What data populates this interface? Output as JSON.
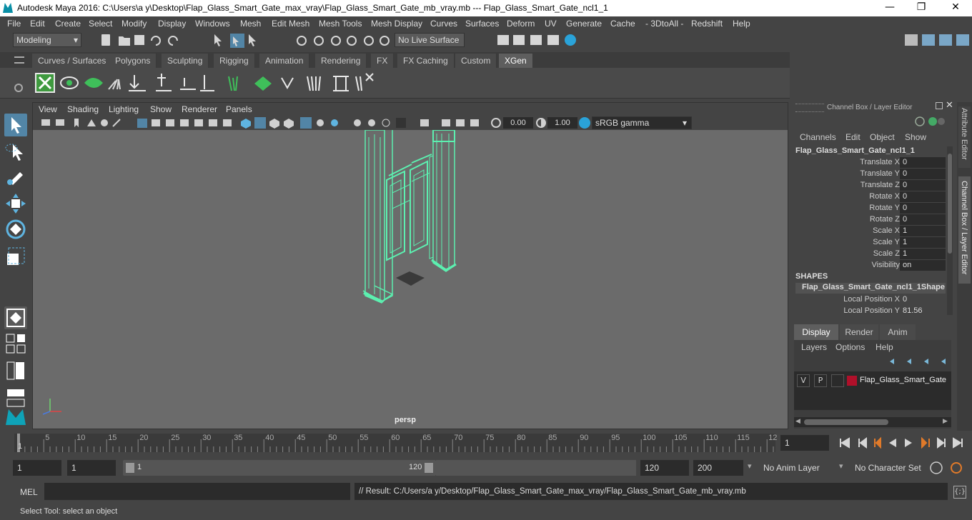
{
  "window": {
    "title": "Autodesk Maya 2016: C:\\Users\\a y\\Desktop\\Flap_Glass_Smart_Gate_max_vray\\Flap_Glass_Smart_Gate_mb_vray.mb   ---   Flap_Glass_Smart_Gate_ncl1_1",
    "minimize": "—",
    "maximize": "❐",
    "close": "✕"
  },
  "menubar": [
    "File",
    "Edit",
    "Create",
    "Select",
    "Modify",
    "Display",
    "Windows",
    "Mesh",
    "Edit Mesh",
    "Mesh Tools",
    "Mesh Display",
    "Curves",
    "Surfaces",
    "Deform",
    "UV",
    "Generate",
    "Cache",
    "- 3DtoAll -",
    "Redshift",
    "Help"
  ],
  "statusline": {
    "mode": "Modeling",
    "live_surface": "No Live Surface"
  },
  "shelf_tabs": [
    "Curves / Surfaces",
    "Polygons",
    "Sculpting",
    "Rigging",
    "Animation",
    "Rendering",
    "FX",
    "FX Caching",
    "Custom",
    "XGen"
  ],
  "shelf_active": "XGen",
  "viewport": {
    "menu": [
      "View",
      "Shading",
      "Lighting",
      "Show",
      "Renderer",
      "Panels"
    ],
    "exposure": "0.00",
    "gamma": "1.00",
    "colorspace": "sRGB gamma",
    "camera_label": "persp"
  },
  "channel_box": {
    "header": "Channel Box / Layer Editor",
    "menu": [
      "Channels",
      "Edit",
      "Object",
      "Show"
    ],
    "object_name": "Flap_Glass_Smart_Gate_ncl1_1",
    "attributes": [
      {
        "label": "Translate X",
        "value": "0"
      },
      {
        "label": "Translate Y",
        "value": "0"
      },
      {
        "label": "Translate Z",
        "value": "0"
      },
      {
        "label": "Rotate X",
        "value": "0"
      },
      {
        "label": "Rotate Y",
        "value": "0"
      },
      {
        "label": "Rotate Z",
        "value": "0"
      },
      {
        "label": "Scale X",
        "value": "1"
      },
      {
        "label": "Scale Y",
        "value": "1"
      },
      {
        "label": "Scale Z",
        "value": "1"
      },
      {
        "label": "Visibility",
        "value": "on"
      }
    ],
    "shapes_header": "SHAPES",
    "shape_name": "Flap_Glass_Smart_Gate_ncl1_1Shape",
    "shape_attributes": [
      {
        "label": "Local Position X",
        "value": "0"
      },
      {
        "label": "Local Position Y",
        "value": "81.56"
      }
    ],
    "layer_tabs": [
      "Display",
      "Render",
      "Anim"
    ],
    "layer_menu": [
      "Layers",
      "Options",
      "Help"
    ],
    "layer": {
      "v": "V",
      "p": "P",
      "name": "Flap_Glass_Smart_Gate",
      "color": "#b0102a"
    },
    "side_tabs": [
      "Attribute Editor",
      "Channel Box / Layer Editor"
    ]
  },
  "timeline": {
    "ticks": [
      "5",
      "10",
      "15",
      "20",
      "25",
      "30",
      "35",
      "40",
      "45",
      "50",
      "55",
      "60",
      "65",
      "70",
      "75",
      "80",
      "85",
      "90",
      "95",
      "100",
      "105",
      "110",
      "115",
      "12"
    ],
    "start_marker": "1",
    "current_frame": "1"
  },
  "range": {
    "start": "1",
    "playback_start": "1",
    "slider_start": "1",
    "slider_end": "120",
    "playback_end": "120",
    "end": "200",
    "anim_layer": "No Anim Layer",
    "character_set": "No Character Set"
  },
  "command": {
    "label": "MEL",
    "result": "// Result: C:/Users/a y/Desktop/Flap_Glass_Smart_Gate_max_vray/Flap_Glass_Smart_Gate_mb_vray.mb"
  },
  "help_line": "Select Tool: select an object",
  "colors": {
    "wireframe": "#5cf0b0",
    "selection": "#5285a6",
    "viewport_bg": "#6b6b6b"
  }
}
